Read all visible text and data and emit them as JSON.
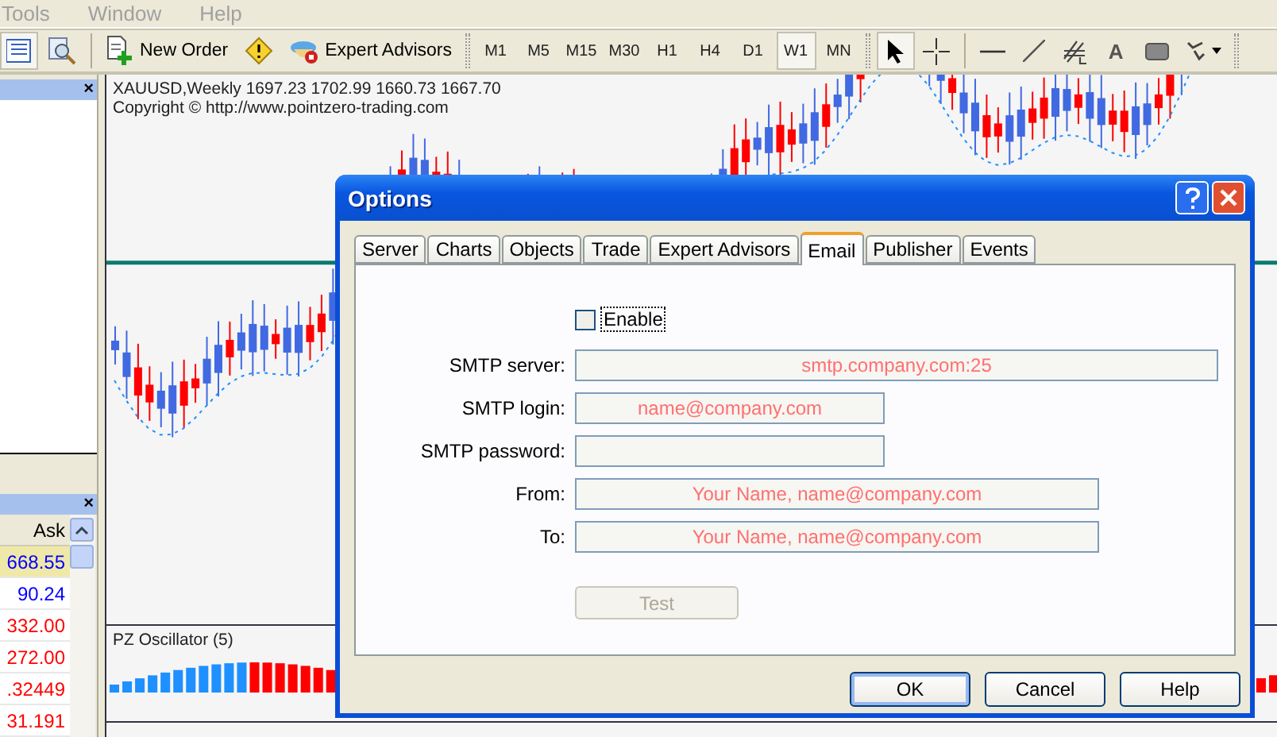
{
  "menu": [
    {
      "label": "Tools"
    },
    {
      "label": "Window"
    },
    {
      "label": "Help"
    }
  ],
  "toolbar": {
    "new_order": "New Order",
    "expert_advisors": "Expert Advisors",
    "timeframes": [
      {
        "label": "M1",
        "selected": false
      },
      {
        "label": "M5",
        "selected": false
      },
      {
        "label": "M15",
        "selected": false
      },
      {
        "label": "M30",
        "selected": false
      },
      {
        "label": "H1",
        "selected": false
      },
      {
        "label": "H4",
        "selected": false
      },
      {
        "label": "D1",
        "selected": false
      },
      {
        "label": "W1",
        "selected": true
      },
      {
        "label": "MN",
        "selected": false
      }
    ],
    "tools": [
      {
        "kind": "cursor",
        "selected": true
      },
      {
        "kind": "crosshair",
        "selected": false
      },
      {
        "kind": "hline",
        "selected": false
      },
      {
        "kind": "trendline",
        "selected": false
      },
      {
        "kind": "fibo",
        "selected": false
      },
      {
        "kind": "text",
        "label": "A",
        "selected": false
      },
      {
        "kind": "rectangle",
        "selected": false
      },
      {
        "kind": "arrows",
        "selected": false
      }
    ]
  },
  "navigator": {
    "close": "×"
  },
  "market_watch": {
    "close": "×",
    "columns": [
      "Ask"
    ],
    "rows": [
      {
        "ask": "668.55",
        "color": "#0000ff",
        "selected": true
      },
      {
        "ask": "90.24",
        "color": "#0000ff",
        "selected": false
      },
      {
        "ask": "332.00",
        "color": "#ff0000",
        "selected": false
      },
      {
        "ask": "272.00",
        "color": "#ff0000",
        "selected": false
      },
      {
        "ask": ".32449",
        "color": "#ff0000",
        "selected": false
      },
      {
        "ask": "31.191",
        "color": "#ff0000",
        "selected": false
      }
    ]
  },
  "chart": {
    "title": "XAUUSD,Weekly  1697.23 1702.99 1660.73 1667.70",
    "copyright": "Copyright © http://www.pointzero-trading.com",
    "indicator": "PZ Oscillator (5)"
  },
  "dialog": {
    "title": "Options",
    "tabs": [
      {
        "label": "Server",
        "selected": false
      },
      {
        "label": "Charts",
        "selected": false
      },
      {
        "label": "Objects",
        "selected": false
      },
      {
        "label": "Trade",
        "selected": false
      },
      {
        "label": "Expert Advisors",
        "selected": false
      },
      {
        "label": "Email",
        "selected": true
      },
      {
        "label": "Publisher",
        "selected": false
      },
      {
        "label": "Events",
        "selected": false
      }
    ],
    "enable": {
      "label": "Enable",
      "checked": false
    },
    "fields": [
      {
        "label": "SMTP server:",
        "value": "smtp.company.com:25"
      },
      {
        "label": "SMTP login:",
        "value": "name@company.com"
      },
      {
        "label": "SMTP password:"
      },
      {
        "label": "From:",
        "value": "Your Name, name@company.com"
      },
      {
        "label": "To:",
        "value": "Your Name, name@company.com"
      }
    ],
    "test_button": {
      "label": "Test",
      "disabled": true
    },
    "buttons": [
      {
        "label": "OK",
        "default": true
      },
      {
        "label": "Cancel",
        "default": false
      },
      {
        "label": "Help",
        "default": false
      }
    ]
  }
}
